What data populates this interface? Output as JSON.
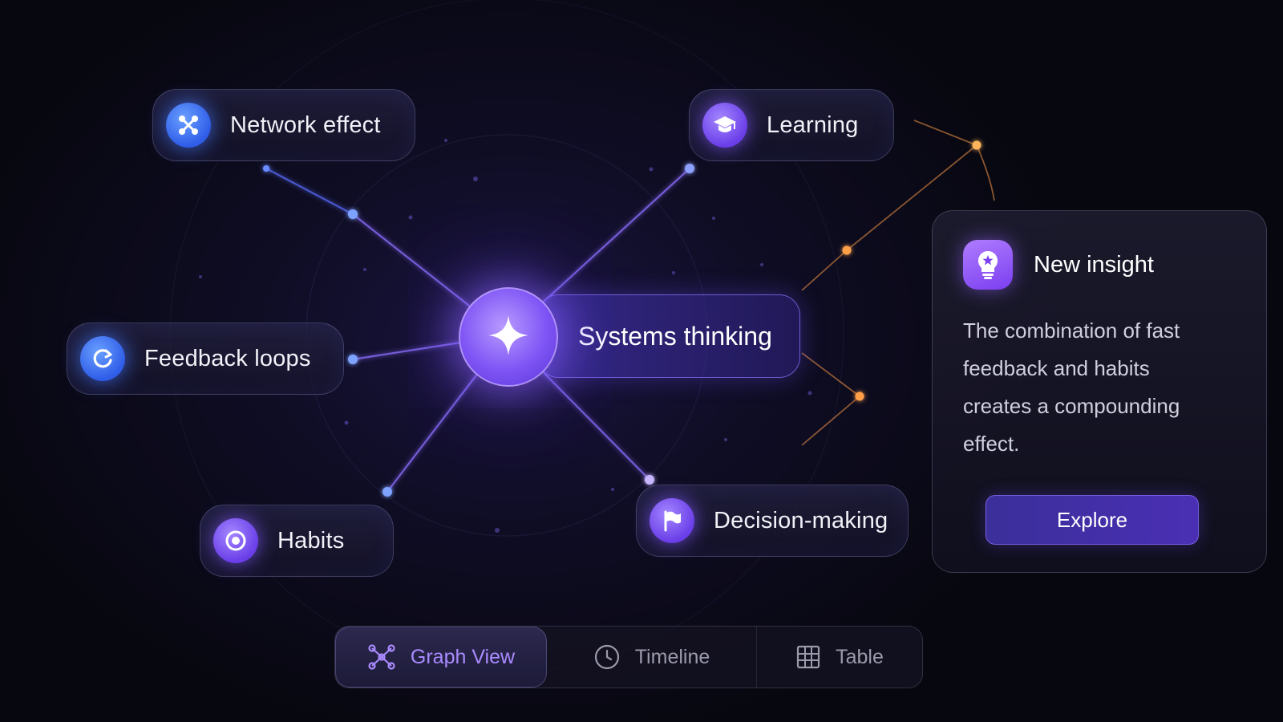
{
  "graph": {
    "center": {
      "label": "Systems thinking",
      "icon": "sparkle-icon"
    },
    "nodes": [
      {
        "id": "network",
        "label": "Network effect",
        "icon": "network-icon"
      },
      {
        "id": "learning",
        "label": "Learning",
        "icon": "graduation-cap-icon"
      },
      {
        "id": "feedback",
        "label": "Feedback loops",
        "icon": "refresh-loop-icon"
      },
      {
        "id": "habits",
        "label": "Habits",
        "icon": "target-icon"
      },
      {
        "id": "decision",
        "label": "Decision-making",
        "icon": "flag-icon"
      }
    ]
  },
  "insight": {
    "title": "New insight",
    "icon": "lightbulb-icon",
    "body": "The combination of fast feedback and habits creates a compounding effect.",
    "button_label": "Explore"
  },
  "view_tabs": [
    {
      "label": "Graph View",
      "icon": "graph-icon",
      "active": true
    },
    {
      "label": "Timeline",
      "icon": "clock-icon",
      "active": false
    },
    {
      "label": "Table",
      "icon": "table-icon",
      "active": false
    }
  ],
  "colors": {
    "accent_purple": "#7f55f5",
    "accent_blue": "#4a7dff",
    "accent_orange": "#f5a04a",
    "active_tab_text": "#a98bff"
  }
}
